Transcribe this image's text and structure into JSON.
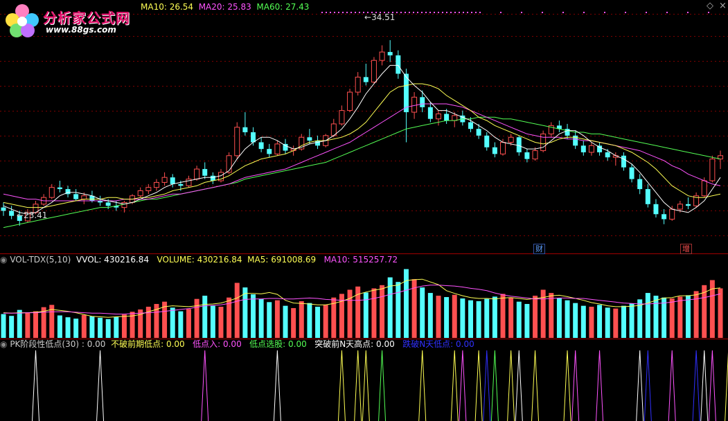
{
  "logo": {
    "title": "分析家公式网",
    "url": "www.88gs.com"
  },
  "main_panel": {
    "ma10": "MA10: 26.54",
    "ma20": "MA20: 25.83",
    "ma60": "MA60: 27.43",
    "high_label": "34.51",
    "low_label": "23.41",
    "markers": [
      "财",
      "增"
    ],
    "colors": {
      "up": "#ff5050",
      "down": "#54ffff",
      "ma5": "#ffffff",
      "ma10": "#ffff54",
      "ma20": "#ff54ff",
      "ma60": "#54ff54",
      "grid": "#800000"
    }
  },
  "vol_panel": {
    "name": "VOL-TDX(5,10)",
    "vvol": "VVOL: 430216.84",
    "volume": "VOLUME: 430216.84",
    "ma5": "MA5: 691008.69",
    "ma10": "MA10: 515257.72"
  },
  "pk_panel": {
    "name": "PK阶段性低点(30) : 0.00",
    "items": [
      {
        "label": "不破前期低点: 0.00",
        "color": "#ffff54"
      },
      {
        "label": "低点入: 0.00",
        "color": "#ff54ff"
      },
      {
        "label": "低点选股: 0.00",
        "color": "#54ff54"
      },
      {
        "label": "突破前N天高点: 0.00",
        "color": "#ffffff"
      },
      {
        "label": "跌破N天低点: 0.00",
        "color": "#3030ff"
      }
    ]
  },
  "chart_data": [
    {
      "type": "candlestick",
      "price_range": [
        22,
        36
      ],
      "high": 34.51,
      "low": 23.41,
      "ohlc": [
        [
          24.5,
          24.8,
          24.0,
          24.3
        ],
        [
          24.3,
          24.6,
          23.8,
          24.0
        ],
        [
          24.0,
          24.3,
          23.41,
          23.7
        ],
        [
          23.7,
          24.4,
          23.6,
          24.2
        ],
        [
          24.2,
          24.9,
          24.1,
          24.7
        ],
        [
          24.7,
          25.3,
          24.6,
          25.1
        ],
        [
          25.1,
          25.9,
          25.0,
          25.7
        ],
        [
          25.7,
          26.1,
          25.4,
          25.6
        ],
        [
          25.6,
          25.8,
          25.1,
          25.3
        ],
        [
          25.3,
          25.6,
          24.9,
          25.0
        ],
        [
          25.0,
          25.4,
          24.7,
          25.2
        ],
        [
          25.2,
          25.5,
          24.8,
          24.9
        ],
        [
          24.9,
          25.2,
          24.6,
          24.8
        ],
        [
          24.8,
          25.0,
          24.4,
          24.6
        ],
        [
          24.6,
          24.9,
          24.3,
          24.5
        ],
        [
          24.5,
          24.9,
          24.2,
          24.8
        ],
        [
          24.8,
          25.3,
          24.7,
          25.2
        ],
        [
          25.2,
          25.7,
          25.1,
          25.5
        ],
        [
          25.5,
          25.9,
          25.3,
          25.7
        ],
        [
          25.7,
          26.2,
          25.5,
          26.0
        ],
        [
          26.0,
          26.6,
          25.8,
          26.3
        ],
        [
          26.3,
          26.5,
          25.7,
          25.9
        ],
        [
          25.9,
          26.1,
          25.5,
          25.8
        ],
        [
          25.8,
          26.4,
          25.7,
          26.2
        ],
        [
          26.2,
          27.0,
          26.1,
          26.8
        ],
        [
          26.8,
          27.2,
          26.2,
          26.4
        ],
        [
          26.4,
          26.6,
          25.9,
          26.1
        ],
        [
          26.1,
          26.8,
          26.0,
          26.6
        ],
        [
          26.6,
          27.8,
          26.5,
          27.6
        ],
        [
          27.6,
          29.6,
          27.4,
          29.3
        ],
        [
          29.3,
          30.2,
          28.8,
          29.0
        ],
        [
          29.0,
          29.3,
          28.2,
          28.4
        ],
        [
          28.4,
          28.7,
          27.8,
          28.0
        ],
        [
          28.0,
          28.3,
          27.5,
          27.7
        ],
        [
          27.7,
          28.5,
          27.6,
          28.3
        ],
        [
          28.3,
          28.6,
          27.7,
          27.9
        ],
        [
          27.9,
          28.2,
          27.6,
          28.0
        ],
        [
          28.0,
          28.9,
          27.9,
          28.7
        ],
        [
          28.7,
          29.2,
          28.3,
          28.5
        ],
        [
          28.5,
          28.8,
          28.0,
          28.2
        ],
        [
          28.2,
          28.9,
          28.1,
          28.8
        ],
        [
          28.8,
          29.8,
          28.7,
          29.5
        ],
        [
          29.5,
          30.6,
          29.4,
          30.3
        ],
        [
          30.3,
          31.6,
          30.2,
          31.4
        ],
        [
          31.4,
          32.6,
          31.2,
          32.3
        ],
        [
          32.3,
          33.1,
          31.8,
          32.0
        ],
        [
          32.0,
          33.5,
          31.9,
          33.3
        ],
        [
          33.3,
          34.2,
          33.0,
          33.8
        ],
        [
          33.8,
          34.51,
          33.2,
          33.6
        ],
        [
          33.6,
          33.9,
          32.2,
          32.5
        ],
        [
          32.5,
          32.8,
          28.4,
          30.2
        ],
        [
          30.2,
          31.4,
          29.8,
          31.1
        ],
        [
          31.1,
          31.5,
          30.2,
          30.5
        ],
        [
          30.5,
          30.8,
          29.6,
          29.8
        ],
        [
          29.8,
          30.3,
          29.4,
          30.1
        ],
        [
          30.1,
          30.4,
          29.5,
          29.7
        ],
        [
          29.7,
          30.2,
          29.3,
          30.0
        ],
        [
          30.0,
          30.3,
          29.4,
          29.6
        ],
        [
          29.6,
          29.9,
          29.0,
          29.2
        ],
        [
          29.2,
          29.5,
          28.6,
          28.8
        ],
        [
          28.8,
          29.0,
          27.9,
          28.1
        ],
        [
          28.1,
          28.4,
          27.5,
          27.7
        ],
        [
          27.7,
          28.6,
          27.6,
          28.4
        ],
        [
          28.4,
          28.9,
          28.2,
          28.7
        ],
        [
          28.7,
          28.8,
          27.6,
          27.8
        ],
        [
          27.8,
          28.0,
          27.2,
          27.4
        ],
        [
          27.4,
          28.1,
          27.3,
          27.9
        ],
        [
          27.9,
          29.1,
          27.8,
          28.9
        ],
        [
          28.9,
          29.6,
          28.7,
          29.4
        ],
        [
          29.4,
          29.7,
          29.0,
          29.2
        ],
        [
          29.2,
          29.5,
          28.6,
          28.8
        ],
        [
          28.8,
          29.1,
          28.0,
          28.2
        ],
        [
          28.2,
          28.5,
          27.6,
          27.8
        ],
        [
          27.8,
          28.4,
          27.6,
          28.2
        ],
        [
          28.2,
          28.4,
          27.6,
          27.8
        ],
        [
          27.8,
          28.0,
          27.3,
          27.5
        ],
        [
          27.5,
          27.8,
          27.0,
          27.6
        ],
        [
          27.6,
          27.8,
          26.7,
          26.9
        ],
        [
          26.9,
          27.1,
          26.0,
          26.2
        ],
        [
          26.2,
          26.5,
          25.3,
          25.6
        ],
        [
          25.6,
          25.9,
          24.5,
          24.7
        ],
        [
          24.7,
          25.0,
          23.9,
          24.1
        ],
        [
          24.1,
          24.4,
          23.5,
          23.8
        ],
        [
          23.8,
          24.6,
          23.7,
          24.4
        ],
        [
          24.4,
          24.9,
          24.2,
          24.7
        ],
        [
          24.7,
          25.1,
          24.4,
          24.6
        ],
        [
          24.6,
          25.4,
          24.5,
          25.2
        ],
        [
          25.2,
          26.3,
          25.1,
          26.1
        ],
        [
          26.1,
          27.6,
          26.0,
          27.4
        ],
        [
          27.4,
          27.9,
          26.8,
          27.6
        ]
      ],
      "ma5": [
        24.6,
        24.4,
        24.2,
        24.1,
        24.2,
        24.5,
        24.8,
        25.2,
        25.4,
        25.4,
        25.3,
        25.2,
        25.0,
        24.9,
        24.8,
        24.7,
        24.8,
        25.0,
        25.2,
        25.4,
        25.7,
        25.9,
        26.0,
        26.1,
        26.2,
        26.3,
        26.3,
        26.4,
        26.7,
        27.4,
        28.0,
        28.4,
        28.7,
        28.7,
        28.5,
        28.2,
        28.0,
        28.1,
        28.3,
        28.4,
        28.5,
        28.8,
        29.2,
        29.8,
        30.5,
        31.3,
        31.9,
        32.5,
        33.0,
        33.0,
        32.3,
        31.8,
        31.4,
        30.8,
        30.3,
        30.3,
        30.1,
        29.9,
        29.7,
        29.4,
        29.1,
        28.7,
        28.4,
        28.3,
        28.2,
        28.0,
        28.0,
        28.1,
        28.5,
        28.9,
        29.1,
        29.1,
        28.8,
        28.4,
        28.1,
        27.9,
        27.6,
        27.4,
        27.1,
        26.6,
        26.0,
        25.4,
        24.8,
        24.4,
        24.3,
        24.2,
        24.5,
        24.9,
        25.6,
        26.3
      ],
      "ma10": [
        24.8,
        24.7,
        24.6,
        24.5,
        24.5,
        24.5,
        24.6,
        24.7,
        24.8,
        24.9,
        25.0,
        25.0,
        25.0,
        25.1,
        25.1,
        25.0,
        25.0,
        25.1,
        25.1,
        25.2,
        25.3,
        25.5,
        25.6,
        25.7,
        25.8,
        26.0,
        26.1,
        26.2,
        26.4,
        26.7,
        27.0,
        27.2,
        27.4,
        27.5,
        27.6,
        27.7,
        27.9,
        28.2,
        28.4,
        28.5,
        28.5,
        28.6,
        28.7,
        28.9,
        29.2,
        29.6,
        30.2,
        30.8,
        31.4,
        31.7,
        31.8,
        31.9,
        31.9,
        31.8,
        31.6,
        31.2,
        30.9,
        30.6,
        30.3,
        29.9,
        29.7,
        29.4,
        29.2,
        29.0,
        28.8,
        28.6,
        28.4,
        28.3,
        28.4,
        28.6,
        28.7,
        28.7,
        28.6,
        28.5,
        28.4,
        28.3,
        28.2,
        28.0,
        27.8,
        27.5,
        27.2,
        26.8,
        26.3,
        25.8,
        25.5,
        25.2,
        25.1,
        25.1,
        25.2,
        25.3
      ],
      "ma20": [
        25.3,
        25.2,
        25.1,
        25.0,
        25.0,
        24.9,
        24.9,
        24.9,
        24.9,
        24.9,
        24.9,
        24.9,
        24.9,
        24.9,
        24.9,
        25.0,
        25.0,
        25.0,
        25.0,
        25.1,
        25.2,
        25.3,
        25.3,
        25.4,
        25.5,
        25.6,
        25.7,
        25.8,
        25.9,
        26.1,
        26.3,
        26.4,
        26.5,
        26.6,
        26.7,
        26.8,
        27.0,
        27.2,
        27.4,
        27.6,
        27.8,
        28.0,
        28.2,
        28.4,
        28.7,
        29.0,
        29.3,
        29.6,
        29.9,
        30.2,
        30.5,
        30.6,
        30.7,
        30.7,
        30.7,
        30.7,
        30.6,
        30.5,
        30.3,
        30.1,
        29.9,
        29.7,
        29.5,
        29.3,
        29.1,
        28.9,
        28.8,
        28.7,
        28.7,
        28.7,
        28.6,
        28.6,
        28.5,
        28.5,
        28.4,
        28.3,
        28.2,
        28.1,
        28.0,
        27.9,
        27.7,
        27.5,
        27.3,
        27.0,
        26.8,
        26.5,
        26.3,
        26.1,
        25.9,
        25.8
      ],
      "ma60": [
        23.3,
        23.4,
        23.5,
        23.6,
        23.7,
        23.8,
        23.9,
        24.0,
        24.1,
        24.2,
        24.3,
        24.4,
        24.5,
        24.5,
        24.6,
        24.7,
        24.8,
        24.9,
        25.0,
        25.0,
        25.1,
        25.2,
        25.3,
        25.4,
        25.5,
        25.6,
        25.7,
        25.8,
        25.9,
        26.0,
        26.2,
        26.3,
        26.4,
        26.5,
        26.6,
        26.7,
        26.8,
        26.9,
        27.0,
        27.1,
        27.2,
        27.4,
        27.6,
        27.8,
        28.0,
        28.2,
        28.4,
        28.6,
        28.8,
        29.0,
        29.2,
        29.3,
        29.4,
        29.5,
        29.6,
        29.7,
        29.7,
        29.8,
        29.8,
        29.9,
        29.9,
        29.9,
        29.8,
        29.8,
        29.7,
        29.6,
        29.5,
        29.4,
        29.3,
        29.2,
        29.1,
        29.0,
        29.0,
        28.9,
        28.9,
        28.8,
        28.7,
        28.6,
        28.5,
        28.4,
        28.3,
        28.2,
        28.1,
        28.0,
        27.9,
        27.8,
        27.7,
        27.6,
        27.5,
        27.4
      ]
    },
    {
      "type": "bar",
      "name": "VOLUME",
      "values": [
        52,
        48,
        61,
        55,
        58,
        67,
        72,
        49,
        45,
        42,
        50,
        47,
        44,
        41,
        46,
        51,
        57,
        62,
        68,
        74,
        79,
        66,
        58,
        63,
        85,
        92,
        70,
        68,
        88,
        120,
        110,
        95,
        85,
        78,
        82,
        70,
        65,
        80,
        76,
        68,
        72,
        88,
        96,
        105,
        112,
        99,
        108,
        115,
        132,
        122,
        150,
        128,
        110,
        98,
        92,
        89,
        94,
        86,
        82,
        80,
        85,
        90,
        96,
        88,
        79,
        74,
        92,
        105,
        98,
        87,
        82,
        76,
        70,
        68,
        72,
        66,
        64,
        70,
        75,
        84,
        98,
        92,
        88,
        86,
        90,
        93,
        102,
        115,
        126,
        108
      ],
      "ma5": [
        55,
        54,
        55,
        55,
        56,
        58,
        62,
        60,
        58,
        55,
        51,
        47,
        46,
        45,
        46,
        47,
        48,
        51,
        57,
        62,
        68,
        70,
        69,
        68,
        70,
        73,
        74,
        76,
        81,
        87,
        97,
        97,
        96,
        99,
        95,
        82,
        76,
        75,
        74,
        72,
        72,
        75,
        80,
        86,
        95,
        100,
        104,
        107,
        113,
        115,
        125,
        127,
        128,
        122,
        116,
        103,
        97,
        92,
        88,
        86,
        86,
        85,
        87,
        88,
        86,
        84,
        86,
        88,
        92,
        93,
        90,
        86,
        82,
        77,
        74,
        70,
        68,
        68,
        69,
        71,
        76,
        82,
        87,
        88,
        92,
        92,
        94,
        99,
        107,
        109
      ],
      "ma10": [
        54,
        54,
        54,
        55,
        55,
        56,
        57,
        57,
        57,
        56,
        55,
        54,
        54,
        53,
        52,
        52,
        53,
        54,
        55,
        56,
        58,
        60,
        62,
        64,
        67,
        70,
        71,
        72,
        75,
        80,
        84,
        85,
        85,
        86,
        86,
        85,
        85,
        86,
        87,
        86,
        84,
        83,
        82,
        82,
        82,
        83,
        86,
        90,
        95,
        99,
        104,
        109,
        113,
        115,
        115,
        114,
        113,
        111,
        108,
        106,
        103,
        98,
        94,
        91,
        89,
        87,
        85,
        85,
        86,
        87,
        87,
        86,
        86,
        84,
        82,
        80,
        78,
        76,
        75,
        74,
        74,
        75,
        76,
        78,
        81,
        83,
        85,
        88,
        92,
        96
      ],
      "max": 160
    },
    {
      "type": "signals",
      "series": [
        {
          "color": "#ffffff",
          "spikes": [
            4,
            12,
            34,
            64,
            79,
            87,
            91,
            100
          ]
        },
        {
          "color": "#ffff54",
          "spikes": [
            42,
            44,
            45,
            52,
            56,
            59,
            63,
            66,
            70,
            90,
            93,
            94
          ]
        },
        {
          "color": "#ff54ff",
          "spikes": [
            25,
            57,
            71,
            74,
            83,
            88,
            95
          ]
        },
        {
          "color": "#3030ff",
          "spikes": [
            60,
            80,
            86,
            92,
            96
          ]
        },
        {
          "color": "#54ff54",
          "spikes": [
            47,
            61
          ]
        }
      ]
    }
  ]
}
